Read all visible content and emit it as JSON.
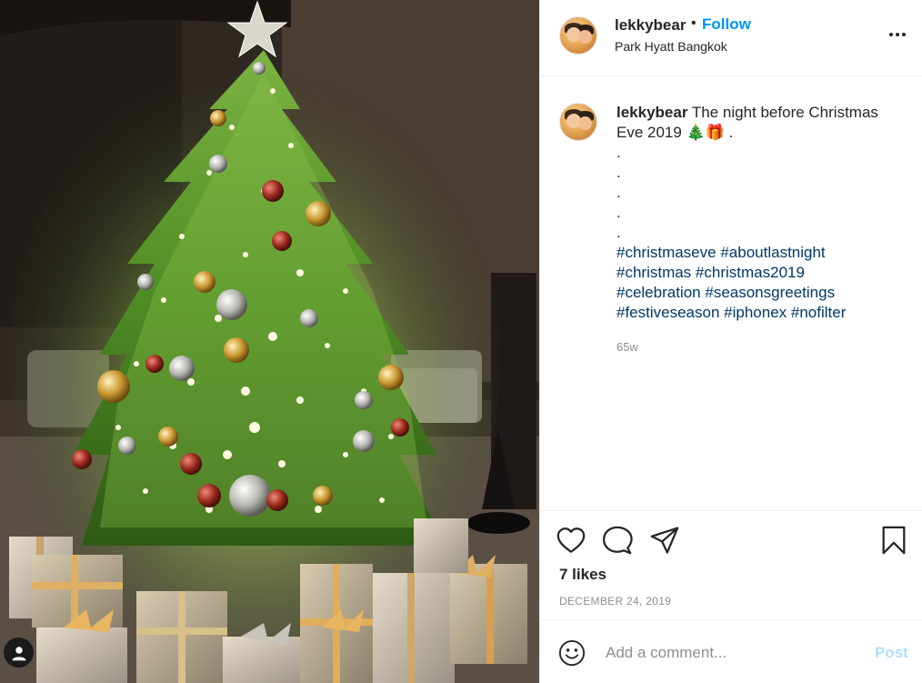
{
  "post": {
    "username": "lekkybear",
    "separator": "•",
    "follow_label": "Follow",
    "location": "Park Hyatt Bangkok",
    "caption_text": "The night before Christmas Eve 2019 🎄🎁 .",
    "caption_dots": [
      ".",
      ".",
      ".",
      ".",
      "."
    ],
    "hashtags_lines": [
      [
        "#christmaseve",
        "#aboutlastnight"
      ],
      [
        "#christmas",
        "#christmas2019"
      ],
      [
        "#celebration",
        "#seasonsgreetings"
      ],
      [
        "#festiveseason",
        "#iphonex",
        "#nofilter"
      ]
    ],
    "time_ago": "65w",
    "likes": "7 likes",
    "date": "DECEMBER 24, 2019",
    "comment_placeholder": "Add a comment...",
    "post_label": "Post"
  },
  "icons": [
    "more-options-icon",
    "heart-icon",
    "comment-icon",
    "share-icon",
    "bookmark-icon",
    "emoji-icon",
    "tagged-user-icon"
  ],
  "colors": {
    "accent": "#0095f6",
    "hashtag": "#00376b",
    "muted": "#8e8e8e",
    "post_disabled": "#b2dffc"
  }
}
